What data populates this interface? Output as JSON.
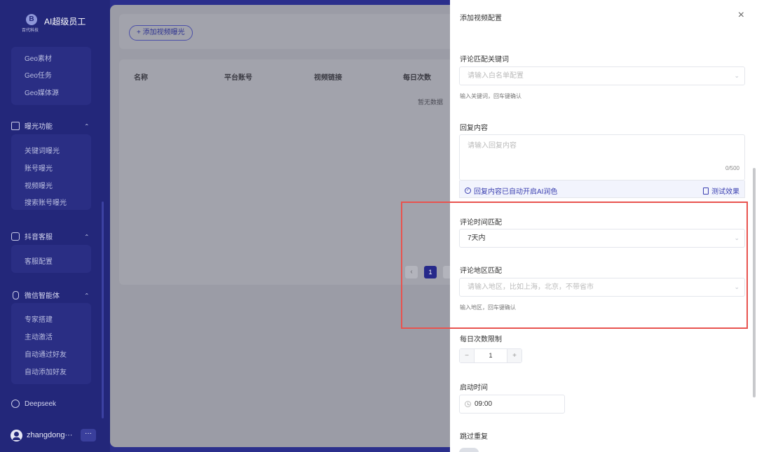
{
  "app": {
    "logo_mark": "B",
    "logo_sub": "百代科技",
    "title": "AI超级员工"
  },
  "sidebar": {
    "geo_items": [
      "Geo素材",
      "Geo任务",
      "Geo媒体源"
    ],
    "groups": [
      {
        "label": "曝光功能",
        "icon": "monitor-icon",
        "items": [
          "关键词曝光",
          "账号曝光",
          "视频曝光",
          "搜索账号曝光"
        ]
      },
      {
        "label": "抖音客服",
        "icon": "chat-icon",
        "items": [
          "客服配置"
        ]
      },
      {
        "label": "微信智能体",
        "icon": "phone-icon",
        "items": [
          "专家搭建",
          "主动激活",
          "自动通过好友",
          "自动添加好友"
        ]
      }
    ],
    "deepseek": "Deepseek",
    "user": {
      "name": "zhangdong···",
      "more": "···"
    }
  },
  "main": {
    "add_button": "+ 添加视频曝光",
    "columns": [
      "名称",
      "平台账号",
      "视频链接",
      "每日次数"
    ],
    "empty_text": "暂无数据",
    "pagination": {
      "prev": "‹",
      "current": "1"
    }
  },
  "drawer": {
    "title": "添加视频配置",
    "close": "×",
    "keyword": {
      "label": "评论匹配关键词",
      "placeholder": "请输入白名单配置",
      "hint": "输入关键词，回车键确认"
    },
    "reply": {
      "label": "回复内容",
      "placeholder": "请输入回复内容",
      "counter": "0/500",
      "ai_note": "回复内容已自动开启AI润色",
      "test": "测试效果"
    },
    "time_match": {
      "label": "评论时间匹配",
      "value": "7天内"
    },
    "region": {
      "label": "评论地区匹配",
      "placeholder": "请输入地区，比如上海，北京，不带省市",
      "hint": "输入地区，回车键确认"
    },
    "daily_limit": {
      "label": "每日次数限制",
      "value": "1",
      "minus": "−",
      "plus": "+"
    },
    "start_time": {
      "label": "启动时间",
      "value": "09:00"
    },
    "skip_repeat": {
      "label": "跳过重复"
    }
  },
  "colors": {
    "sidebar": "#23277a",
    "accent": "#3a3fb0",
    "highlight": "#e8534f"
  }
}
